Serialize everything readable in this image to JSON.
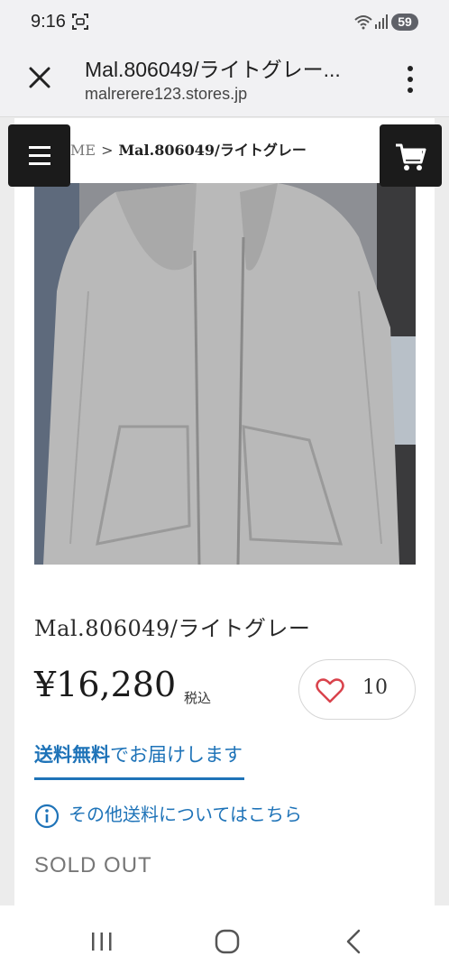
{
  "status_bar": {
    "time": "9:16",
    "battery": "59"
  },
  "browser": {
    "title": "Mal.806049/ライトグレー...",
    "url": "malrerere123.stores.jp"
  },
  "breadcrumb": {
    "home": "ME",
    "separator": ">",
    "current": "Mal.806049/ライトグレー"
  },
  "product": {
    "name": "Mal.806049/ライトグレー",
    "price": "¥16,280",
    "tax_label": "税込",
    "like_count": "10",
    "shipping_bold": "送料無料",
    "shipping_rest": "でお届けします",
    "shipping_info_link": "その他送料についてはこちら",
    "status": "SOLD OUT"
  },
  "colors": {
    "accent_blue": "#1e73b8",
    "heart_red": "#d9434c",
    "dark_button": "#1b1b1b"
  },
  "icons": {
    "close": "close-icon",
    "menu": "more-vert-icon",
    "hamburger": "hamburger-icon",
    "cart": "cart-icon",
    "heart": "heart-icon",
    "info": "info-icon"
  }
}
